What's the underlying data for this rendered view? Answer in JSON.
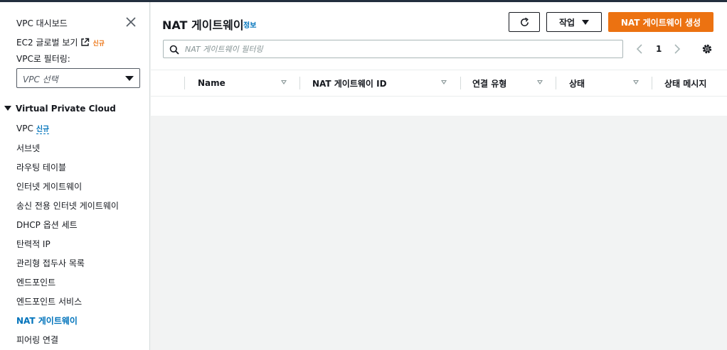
{
  "sidebar": {
    "dashboard_label": "VPC 대시보드",
    "ec2_global_label": "EC2 글로벌 보기",
    "ec2_global_badge": "신규",
    "filter_label": "VPC로 필터링:",
    "vpc_select_value": "VPC 선택",
    "section_title": "Virtual Private Cloud",
    "items": [
      {
        "label": "VPC",
        "badge": "신규"
      },
      {
        "label": "서브넷"
      },
      {
        "label": "라우팅 테이블"
      },
      {
        "label": "인터넷 게이트웨이"
      },
      {
        "label": "송신 전용 인터넷 게이트웨이"
      },
      {
        "label": "DHCP 옵션 세트"
      },
      {
        "label": "탄력적 IP"
      },
      {
        "label": "관리형 접두사 목록"
      },
      {
        "label": "엔드포인트"
      },
      {
        "label": "엔드포인트 서비스"
      },
      {
        "label": "NAT 게이트웨이"
      },
      {
        "label": "피어링 연결"
      }
    ],
    "active_item": "NAT 게이트웨이"
  },
  "header": {
    "title": "NAT 게이트웨이",
    "info_link": "정보",
    "action_button": "작업",
    "create_button": "NAT 게이트웨이 생성"
  },
  "search": {
    "placeholder": "NAT 게이트웨이 필터링",
    "value": ""
  },
  "pagination": {
    "current_page": "1"
  },
  "table": {
    "columns": [
      "Name",
      "NAT 게이트웨이 ID",
      "연결 유형",
      "상태",
      "상태 메시지"
    ],
    "rows": []
  },
  "colors": {
    "primary_button": "#ec7211",
    "link": "#0073bb",
    "new_badge": "#ec7211"
  }
}
